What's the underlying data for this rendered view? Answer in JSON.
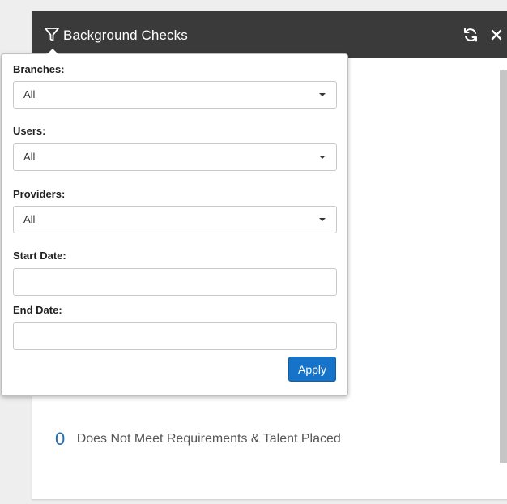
{
  "widget": {
    "title": "Background Checks",
    "icons": {
      "filter": "filter-icon",
      "refresh": "refresh-icon",
      "close": "close-icon"
    },
    "metric": {
      "count": "0",
      "label": "Does Not Meet Requirements & Talent Placed"
    }
  },
  "filter": {
    "branches": {
      "label": "Branches:",
      "selected": "All"
    },
    "users": {
      "label": "Users:",
      "selected": "All"
    },
    "providers": {
      "label": "Providers:",
      "selected": "All"
    },
    "start_date": {
      "label": "Start Date:",
      "value": "",
      "placeholder": ""
    },
    "end_date": {
      "label": "End Date:",
      "value": "",
      "placeholder": ""
    },
    "apply_label": "Apply"
  },
  "colors": {
    "header_bg": "#3a3a3a",
    "accent": "#1574c9",
    "count": "#1f6fb2"
  }
}
